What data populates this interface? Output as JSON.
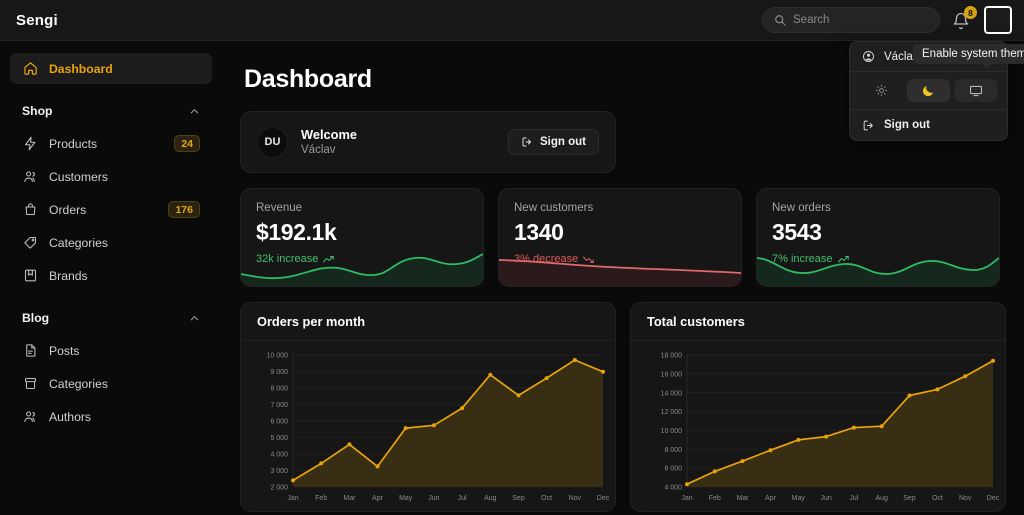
{
  "app": {
    "brand": "Sengi"
  },
  "header": {
    "search": {
      "placeholder": "Search",
      "icon": "search-icon"
    },
    "notifications": {
      "icon": "bell-icon",
      "count": "8"
    },
    "avatar": {
      "icon": "user-avatar"
    }
  },
  "account_menu": {
    "user_name": "Václav V",
    "user_icon": "user-circle-icon",
    "themes": [
      {
        "name": "light",
        "icon": "sun-icon",
        "selected": false
      },
      {
        "name": "dark",
        "icon": "moon-icon",
        "selected": true
      },
      {
        "name": "system",
        "icon": "monitor-icon",
        "selected": false
      }
    ],
    "sign_out_label": "Sign out",
    "sign_out_icon": "logout-icon",
    "tooltip": "Enable system theme"
  },
  "sidebar": {
    "primary": [
      {
        "label": "Dashboard",
        "icon": "home-icon",
        "active": true,
        "badge": ""
      }
    ],
    "groups": [
      {
        "label": "Shop",
        "chevron": "chevron-up-icon",
        "items": [
          {
            "label": "Products",
            "icon": "bolt-icon",
            "badge": "24"
          },
          {
            "label": "Customers",
            "icon": "users-icon",
            "badge": ""
          },
          {
            "label": "Orders",
            "icon": "bag-icon",
            "badge": "176"
          },
          {
            "label": "Categories",
            "icon": "tag-icon",
            "badge": ""
          },
          {
            "label": "Brands",
            "icon": "bookmark-icon",
            "badge": ""
          }
        ]
      },
      {
        "label": "Blog",
        "chevron": "chevron-up-icon",
        "items": [
          {
            "label": "Posts",
            "icon": "document-icon",
            "badge": ""
          },
          {
            "label": "Categories",
            "icon": "archive-icon",
            "badge": ""
          },
          {
            "label": "Authors",
            "icon": "users-icon",
            "badge": ""
          }
        ]
      }
    ]
  },
  "main": {
    "page_title": "Dashboard",
    "welcome": {
      "initials": "DU",
      "title": "Welcome",
      "subtitle": "Václav",
      "sign_out_label": "Sign out",
      "sign_out_icon": "logout-icon"
    },
    "stats": [
      {
        "label": "Revenue",
        "value": "$192.1k",
        "delta": "32k increase",
        "direction": "up",
        "color": "#3fbf6e",
        "icon": "trend-up-icon"
      },
      {
        "label": "New customers",
        "value": "1340",
        "delta": "3% decrease",
        "direction": "down",
        "color": "#e05a5a",
        "icon": "trend-down-icon"
      },
      {
        "label": "New orders",
        "value": "3543",
        "delta": "7% increase",
        "direction": "up",
        "color": "#3fbf6e",
        "icon": "trend-up-icon"
      }
    ]
  },
  "chart_data": [
    {
      "type": "area",
      "title": "Orders per month",
      "xlabel": "",
      "ylabel": "",
      "categories": [
        "Jan",
        "Feb",
        "Mar",
        "Apr",
        "May",
        "Jun",
        "Jul",
        "Aug",
        "Sep",
        "Oct",
        "Nov",
        "Dec"
      ],
      "values": [
        2400,
        3430,
        4580,
        3250,
        5570,
        5740,
        6780,
        8800,
        7550,
        8600,
        9700,
        8980
      ],
      "yticks": [
        "2 000",
        "3 000",
        "4 000",
        "5 000",
        "6 000",
        "7 000",
        "8 000",
        "9 000",
        "10 000"
      ],
      "ylim": [
        2000,
        10000
      ],
      "grid": true,
      "legend": "none",
      "line_color": "#e8a30c",
      "fill_color": "#3a2f13"
    },
    {
      "type": "area",
      "title": "Total customers",
      "xlabel": "",
      "ylabel": "",
      "categories": [
        "Jan",
        "Feb",
        "Mar",
        "Apr",
        "May",
        "Jun",
        "Jul",
        "Aug",
        "Sep",
        "Oct",
        "Nov",
        "Dec"
      ],
      "values": [
        4300,
        5650,
        6750,
        7900,
        9000,
        9350,
        10300,
        10450,
        13700,
        14350,
        15750,
        17400
      ],
      "yticks": [
        "4 000",
        "6 000",
        "8 000",
        "10 000",
        "12 000",
        "14 000",
        "16 000",
        "18 000"
      ],
      "ylim": [
        4000,
        18000
      ],
      "grid": true,
      "legend": "none",
      "line_color": "#e8a30c",
      "fill_color": "#3a2f13"
    }
  ]
}
